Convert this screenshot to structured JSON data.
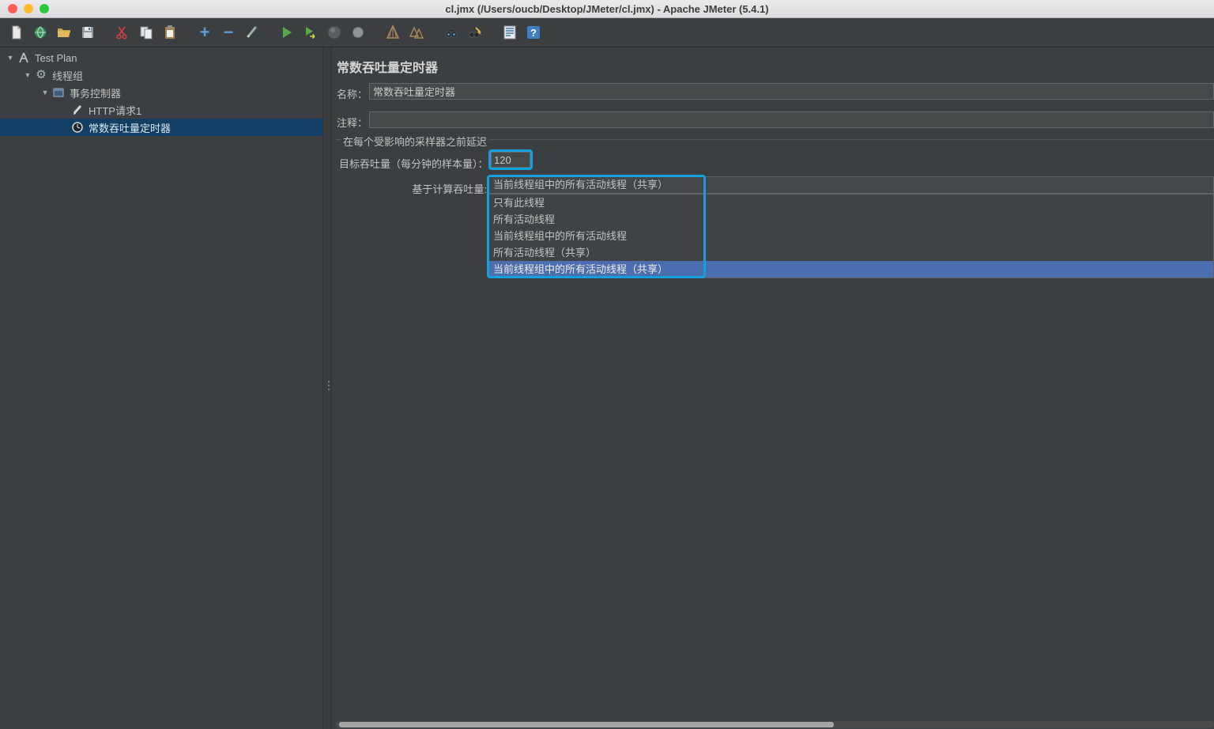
{
  "window": {
    "title": "cl.jmx (/Users/oucb/Desktop/JMeter/cl.jmx) - Apache JMeter (5.4.1)"
  },
  "icons": {
    "expander_open": "▼",
    "divider_grip": "⋮",
    "add_glyph": "+",
    "remove_glyph": "−",
    "gear_glyph": "⚙",
    "help_glyph": "?"
  },
  "toolbar": {
    "items": [
      "new-file",
      "templates",
      "open-file",
      "save",
      "cut",
      "copy",
      "paste",
      "add",
      "remove",
      "toggle",
      "start",
      "start-no-pauses",
      "stop",
      "shutdown",
      "clear",
      "clear-all",
      "search",
      "search-reset",
      "function-helper",
      "help"
    ]
  },
  "tree": {
    "items": [
      {
        "label": "Test Plan",
        "depth": 0,
        "expanded": true,
        "selected": false
      },
      {
        "label": "线程组",
        "depth": 1,
        "expanded": true,
        "selected": false
      },
      {
        "label": "事务控制器",
        "depth": 2,
        "expanded": true,
        "selected": false
      },
      {
        "label": "HTTP请求1",
        "depth": 3,
        "expanded": false,
        "selected": false
      },
      {
        "label": "常数吞吐量定时器",
        "depth": 3,
        "expanded": false,
        "selected": true
      }
    ]
  },
  "main": {
    "title": "常数吞吐量定时器",
    "fields": {
      "name_label": "名称：",
      "name_value": "常数吞吐量定时器",
      "comments_label": "注释：",
      "comments_value": ""
    },
    "group": {
      "title": "在每个受影响的采样器之前延迟",
      "throughput_label": "目标吞吐量（每分钟的样本量）：",
      "throughput_value": "120",
      "calc_label": "基于计算吞吐量:",
      "combo_selected": "当前线程组中的所有活动线程（共享）",
      "dropdown_options": [
        {
          "label": "只有此线程",
          "selected": false
        },
        {
          "label": "所有活动线程",
          "selected": false
        },
        {
          "label": "当前线程组中的所有活动线程",
          "selected": false
        },
        {
          "label": "所有活动线程（共享）",
          "selected": false
        },
        {
          "label": "当前线程组中的所有活动线程（共享）",
          "selected": true
        }
      ]
    }
  },
  "colors": {
    "panel_bg": "#3c3f41",
    "text": "#c2c2c2",
    "tree_selection_bg": "#123f63",
    "dropdown_selection_bg": "#4b6eaf",
    "annotation_highlight": "#14a0dc",
    "titlebar_bg": "#e9e7e9",
    "traffic_red": "#ff5f57",
    "traffic_yellow": "#febc2e",
    "traffic_green": "#28c840"
  }
}
